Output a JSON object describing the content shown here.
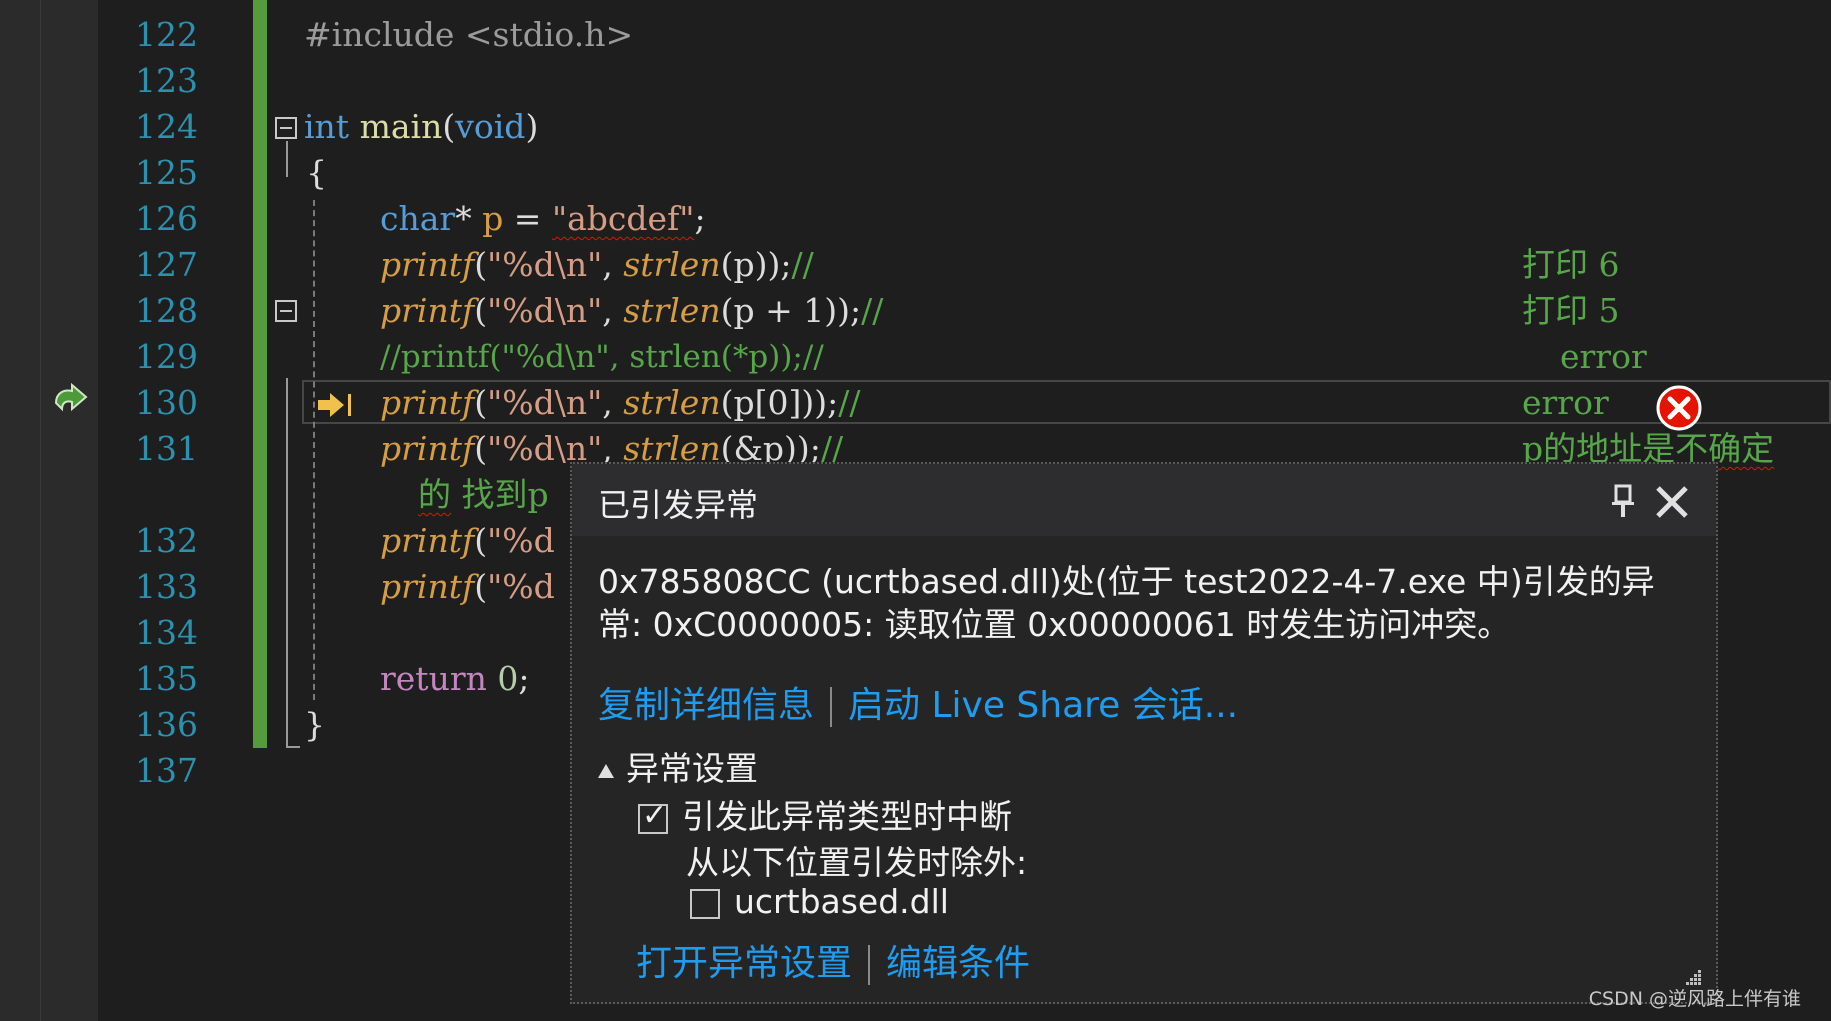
{
  "editor": {
    "line_numbers": [
      "122",
      "123",
      "124",
      "125",
      "126",
      "127",
      "128",
      "129",
      "130",
      "131",
      "132",
      "133",
      "134",
      "135",
      "136",
      "137"
    ],
    "lines": {
      "l122": {
        "include": "#include <stdio.h>"
      },
      "l124": {
        "kw_int": "int",
        "fn_main": "main",
        "paren_open": "(",
        "kw_void": "void",
        "paren_close": ")"
      },
      "l125": {
        "brace": "{"
      },
      "l126": {
        "kw_char": "char",
        "star": "* ",
        "var": "p",
        "eq": " = ",
        "str": "\"abcdef\"",
        "semi": ";"
      },
      "l127": {
        "printf": "printf",
        "open": "(",
        "fmt": "\"%d\\n\"",
        "comma": ", ",
        "strlen": "strlen",
        "args": "(p));",
        "comment": "//",
        "note": "打印 6"
      },
      "l128": {
        "printf": "printf",
        "open": "(",
        "fmt": "\"%d\\n\"",
        "comma": ", ",
        "strlen": "strlen",
        "args": "(p + 1));",
        "comment": "//",
        "note": "打印 5"
      },
      "l129": {
        "comment": "//printf(\"%d\\n\", strlen(*p));//",
        "note": "error"
      },
      "l130": {
        "printf": "printf",
        "open": "(",
        "fmt": "\"%d\\n\"",
        "comma": ", ",
        "strlen": "strlen",
        "args": "(p[0]));",
        "comment": "//",
        "note": "error"
      },
      "l131": {
        "printf": "printf",
        "open": "(",
        "fmt": "\"%d\\n\"",
        "comma": ", ",
        "strlen": "strlen",
        "args": "(&p));",
        "comment": "//",
        "note": "p的地址是不确定"
      },
      "l131b": {
        "text1": "的",
        "text2": " 找到p"
      },
      "l132": {
        "printf": "printf",
        "open": "(",
        "fmt": "\"%d"
      },
      "l133": {
        "printf": "printf",
        "open": "(",
        "fmt": "\"%d"
      },
      "l135": {
        "kw_return": "return",
        "num": " 0",
        "semi": ";"
      },
      "l136": {
        "brace": "}"
      }
    }
  },
  "exception_popup": {
    "title": "已引发异常",
    "message": "0x785808CC (ucrtbased.dll)处(位于 test2022-4-7.exe 中)引发的异常: 0xC0000005: 读取位置 0x00000061 时发生访问冲突。",
    "link_copy": "复制详细信息",
    "link_liveshare": "启动 Live Share 会话...",
    "section_title": "异常设置",
    "checkbox_break": "引发此异常类型时中断",
    "checkbox_break_checked": true,
    "except_label": "从以下位置引发时除外:",
    "checkbox_dll": "ucrtbased.dll",
    "checkbox_dll_checked": false,
    "link_open_settings": "打开异常设置",
    "link_edit_conditions": "编辑条件"
  },
  "watermark": "CSDN @逆风路上伴有谁",
  "colors": {
    "accent_link": "#1f9cf0",
    "change_bar": "#579a3c",
    "line_number": "#2b91af",
    "error": "#e51400"
  }
}
